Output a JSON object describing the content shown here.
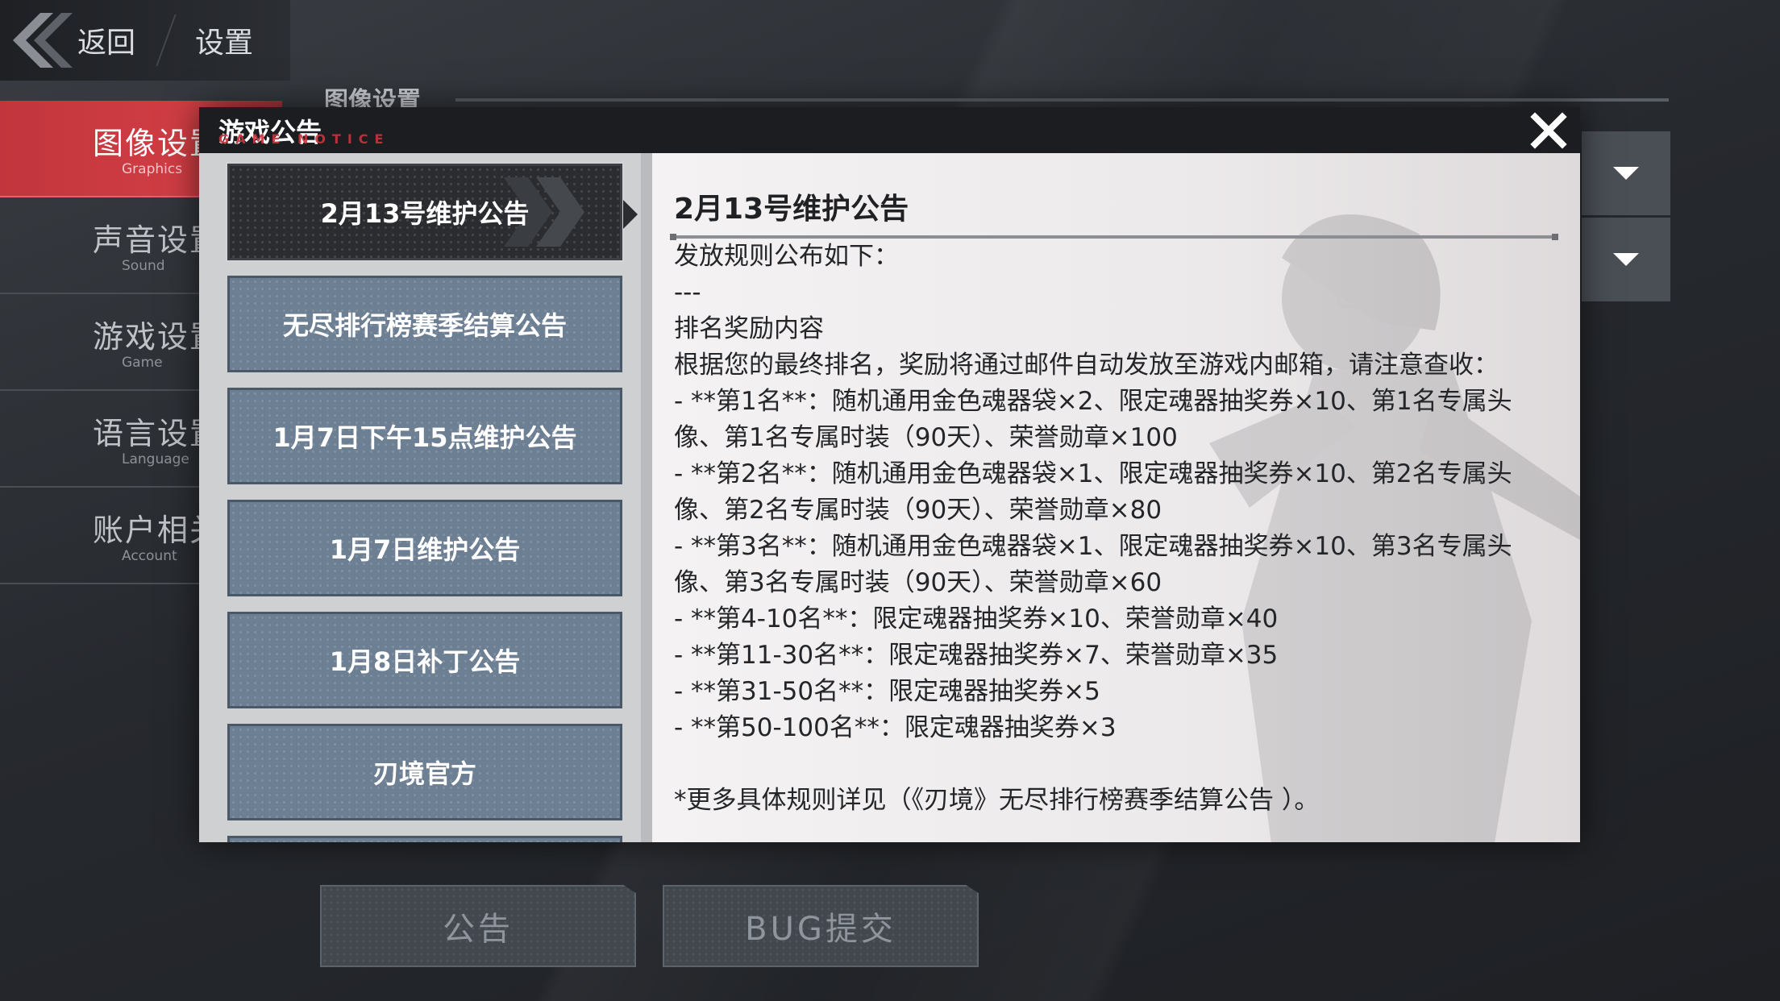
{
  "top_bar": {
    "back_label": "返回",
    "settings_label": "设置"
  },
  "sidebar": {
    "items": [
      {
        "cn": "图像设置",
        "en": "Graphics",
        "active": true
      },
      {
        "cn": "声音设置",
        "en": "Sound",
        "active": false
      },
      {
        "cn": "游戏设置",
        "en": "Game",
        "active": false
      },
      {
        "cn": "语言设置",
        "en": "Language",
        "active": false
      },
      {
        "cn": "账户相关",
        "en": "Account",
        "active": false
      }
    ]
  },
  "section": {
    "title": "图像设置"
  },
  "bottom_buttons": {
    "notice": "公告",
    "bug": "BUG提交"
  },
  "modal": {
    "title": "游戏公告",
    "subtitle": "GAME NOTICE",
    "list": [
      "2月13号维护公告",
      "无尽排行榜赛季结算公告",
      "1月7日下午15点维护公告",
      "1月7日维护公告",
      "1月8日补丁公告",
      "刃境官方"
    ],
    "selected_index": 0,
    "content": {
      "title": "2月13号维护公告",
      "lines": [
        "发放规则公布如下：",
        "---",
        "排名奖励内容",
        "根据您的最终排名，奖励将通过邮件自动发放至游戏内邮箱，请注意查收：",
        "- **第1名**：随机通用金色魂器袋×2、限定魂器抽奖券×10、第1名专属头",
        "像、第1名专属时装（90天）、荣誉勋章×100",
        "- **第2名**：随机通用金色魂器袋×1、限定魂器抽奖券×10、第2名专属头",
        "像、第2名专属时装（90天）、荣誉勋章×80",
        "- **第3名**：随机通用金色魂器袋×1、限定魂器抽奖券×10、第3名专属头",
        "像、第3名专属时装（90天）、荣誉勋章×60",
        "- **第4-10名**：限定魂器抽奖券×10、荣誉勋章×40",
        "- **第11-30名**：限定魂器抽奖券×7、荣誉勋章×35",
        "- **第31-50名**：限定魂器抽奖券×5",
        "- **第50-100名**：限定魂器抽奖券×3",
        "",
        "*更多具体规则详见（《刃境》无尽排行榜赛季结算公告 ）。"
      ]
    }
  },
  "colors": {
    "accent_red": "#c2353c",
    "list_item_bg": "#6d7f93",
    "selected_item_bg": "#2a2c30"
  }
}
